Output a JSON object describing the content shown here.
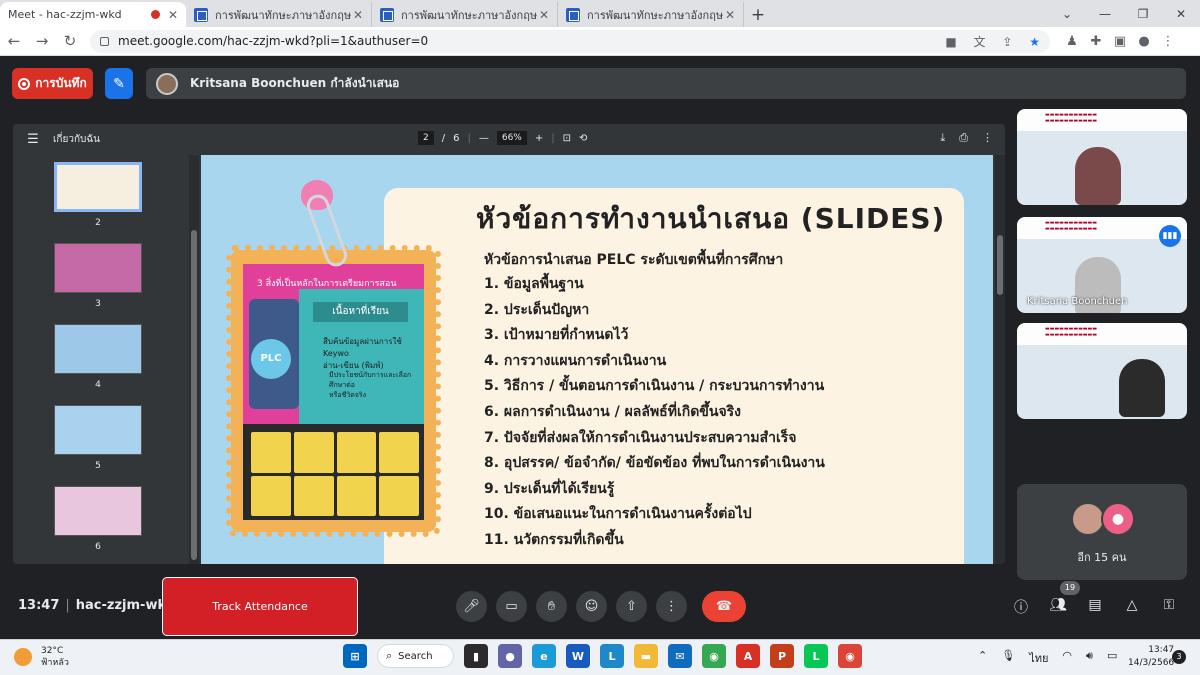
{
  "browser": {
    "tabs": [
      {
        "title": "Meet - hac-zzjm-wkd",
        "icon": "meet-icon",
        "active": true,
        "recording": true
      },
      {
        "title": "การพัฒนาทักษะภาษาอังกฤษ English",
        "icon": "doc-icon"
      },
      {
        "title": "การพัฒนาทักษะภาษาอังกฤษ English",
        "icon": "doc-icon"
      },
      {
        "title": "การพัฒนาทักษะภาษาอังกฤษ English",
        "icon": "doc-icon"
      }
    ],
    "new_tab": "+",
    "url": "meet.google.com/hac-zzjm-wkd?pli=1&authuser=0"
  },
  "meet": {
    "record_label": "การบันทึก",
    "presenter_text": "Kritsana Boonchuen กำลังนำเสนอ",
    "meeting_time": "13:47",
    "meeting_code": "hac-zzjm-wkd",
    "track_attendance": "Track Attendance",
    "participants_badge": "19",
    "others_label": "อีก 15 คน",
    "participant_name": "Kritsana Boonchuen",
    "colors": {
      "record": "#d93025",
      "end_call": "#ea4335",
      "accent": "#1a73e8"
    }
  },
  "pdf": {
    "doc_title": "เกี่ยวกับฉัน",
    "page_current": "2",
    "page_sep": "/",
    "page_total": "6",
    "zoom": "66%",
    "thumbs": [
      {
        "num": "2",
        "active": true
      },
      {
        "num": "3"
      },
      {
        "num": "4"
      },
      {
        "num": "5"
      },
      {
        "num": "6"
      }
    ]
  },
  "slide": {
    "title": "หัวข้อการทำงานนำเสนอ (SLIDES)",
    "subtitle": "หัวข้อการนำเสนอ PELC ระดับเขตพื้นที่การศึกษา",
    "items": [
      "1. ข้อมูลพื้นฐาน",
      "2. ประเด็นปัญหา",
      "3. เป้าหมายที่กำหนดไว้",
      "4. การวางแผนการดำเนินงาน",
      "5. วิธีการ / ขั้นตอนการดำเนินงาน / กระบวนการทำงาน",
      "6. ผลการดำเนินงาน / ผลลัพธ์ที่เกิดขึ้นจริง",
      "7. ปัจจัยที่ส่งผลให้การดำเนินงานประสบความสำเร็จ",
      "8. อุปสรรค/ ข้อจำกัด/ ข้อขัดข้อง ที่พบในการดำเนินงาน",
      "9. ประเด็นที่ได้เรียนรู้",
      "10. ข้อเสนอแนะในการดำเนินงานครั้งต่อไป",
      "11. นวัตกรรมที่เกิดขึ้น"
    ],
    "photo_title": "3 สิ่งที่เป็นหลักในการเตรียมการสอน",
    "photo_label": "เนื้อหาที่เรียน",
    "photo_text1": "สืบค้นข้อมูลผ่านการใช้ Keywo",
    "photo_text2": "อ่าน-เขียน (พิมพ์)",
    "photo_text3": "มีประโยชน์กับการและเลือกศึกษาต่อ",
    "photo_text4": "หรือชีวิตจริง",
    "photo_badge": "PLC"
  },
  "taskbar": {
    "temp": "32°C",
    "weather": "ฟ้าหลัว",
    "search": "Search",
    "lang": "ไทย",
    "time": "13:47",
    "date": "14/3/2566",
    "notifications": "3"
  }
}
